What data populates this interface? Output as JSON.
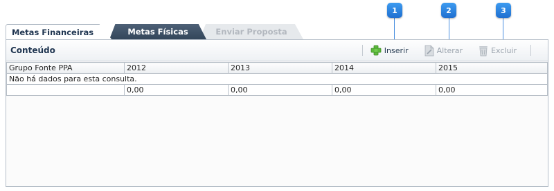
{
  "callouts": [
    "1",
    "2",
    "3"
  ],
  "tabs": [
    {
      "label": "Metas Financeiras",
      "state": "active"
    },
    {
      "label": "Metas Físicas",
      "state": "inactive"
    },
    {
      "label": "Enviar Proposta",
      "state": "disabled"
    }
  ],
  "panel": {
    "title": "Conteúdo"
  },
  "toolbar": {
    "insert": {
      "label": "Inserir",
      "icon": "plus-icon",
      "enabled": true
    },
    "edit": {
      "label": "Alterar",
      "icon": "document-edit-icon",
      "enabled": false
    },
    "delete": {
      "label": "Excluir",
      "icon": "trash-icon",
      "enabled": false
    }
  },
  "table": {
    "columns": [
      "Grupo Fonte PPA",
      "2012",
      "2013",
      "2014",
      "2015"
    ],
    "empty_message": "Não há dados para esta consulta.",
    "totals": [
      "",
      "0,00",
      "0,00",
      "0,00",
      "0,00"
    ]
  },
  "colors": {
    "accent": "#1f6fd0",
    "tab_dark": "#3b4e63",
    "plus_green": "#5cb83c",
    "border": "#b5bec8"
  }
}
